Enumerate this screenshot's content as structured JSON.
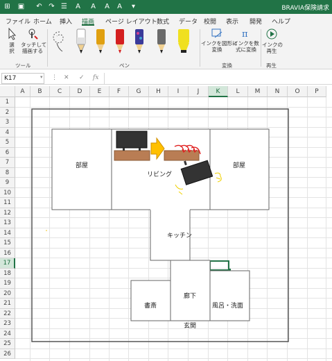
{
  "app": {
    "window_title": "BRAVIA保険請求"
  },
  "tabs": [
    {
      "label": "ファイル"
    },
    {
      "label": "ホーム"
    },
    {
      "label": "挿入"
    },
    {
      "label": "描画"
    },
    {
      "label": "ページ レイアウト"
    },
    {
      "label": "数式"
    },
    {
      "label": "データ"
    },
    {
      "label": "校閲"
    },
    {
      "label": "表示"
    },
    {
      "label": "開発"
    },
    {
      "label": "ヘルプ"
    }
  ],
  "active_tab": "描画",
  "ribbon": {
    "tools": {
      "select_label": "選\n択",
      "touch_label": "タッチして\n描画する",
      "group_label": "ツール"
    },
    "pens": {
      "group_label": "ペン",
      "colors": [
        "#222222",
        "#e0a010",
        "#d42020",
        "#3a3a9a",
        "#6a6a6a",
        "#f0e020"
      ]
    },
    "convert": {
      "ink_to_shape_label": "インクを図形に\n変換",
      "ink_to_math_label": "インクを数\n式に変換",
      "group_label": "変換"
    },
    "replay": {
      "ink_replay_label": "インクの\n再生",
      "group_label": "再生"
    }
  },
  "formula_bar": {
    "name_box": "K17",
    "cancel_icon": "✕",
    "enter_icon": "✓",
    "fx_label": "fx",
    "formula": ""
  },
  "columns": [
    "A",
    "B",
    "C",
    "D",
    "E",
    "F",
    "G",
    "H",
    "I",
    "J",
    "K",
    "L",
    "M",
    "N",
    "O",
    "P"
  ],
  "selected_column": "K",
  "rows": [
    "1",
    "2",
    "3",
    "4",
    "5",
    "6",
    "7",
    "8",
    "9",
    "10",
    "11",
    "12",
    "13",
    "14",
    "15",
    "16",
    "17",
    "18",
    "19",
    "20",
    "21",
    "22",
    "23",
    "24",
    "25",
    "26"
  ],
  "selected_row": "17",
  "floorplan": {
    "room_left": "部屋",
    "living": "リビング",
    "room_right": "部屋",
    "kitchen": "キッチン",
    "study": "書斎",
    "hallway": "廊下",
    "bath": "風呂・洗面",
    "entrance": "玄関"
  },
  "colors": {
    "excel_green": "#217346",
    "table_brown": "#b97d54",
    "arrow_orange": "#ffc000",
    "ink_red": "#e02020",
    "tv_black": "#333333"
  }
}
